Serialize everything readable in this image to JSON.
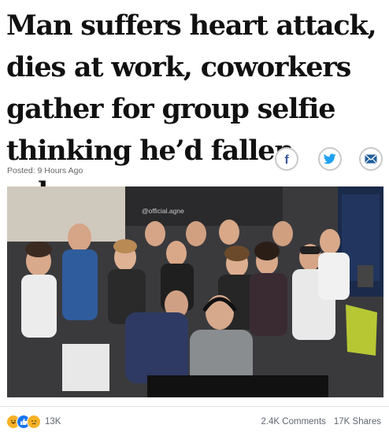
{
  "post": {
    "headline": "Man suffers heart attack, dies at work, coworkers gather for group selfie thinking he’d fallen asleep",
    "posted": "Posted: 9 Hours Ago",
    "share": {
      "facebook_icon": "facebook-icon",
      "twitter_icon": "twitter-icon",
      "email_icon": "envelope-icon",
      "facebook_color": "#3b5998",
      "twitter_color": "#1da1f2",
      "email_color": "#1f5c99"
    },
    "photo": {
      "watermark": "@official.agne"
    }
  },
  "footer": {
    "reactions": [
      "haha",
      "like",
      "sad"
    ],
    "reaction_count": "13K",
    "comments": "2.4K Comments",
    "shares": "17K Shares"
  }
}
